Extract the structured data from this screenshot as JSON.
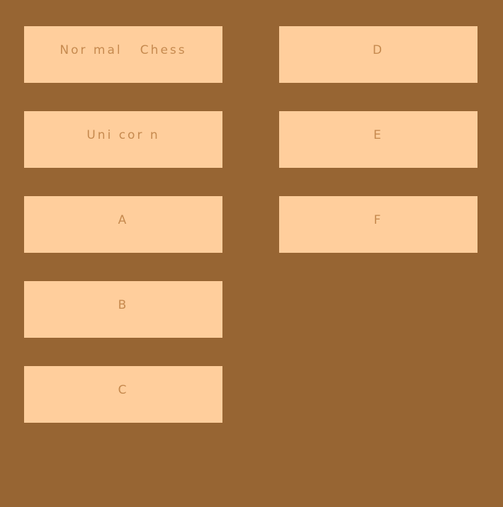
{
  "buttons": [
    {
      "label": "Nor mal   Chess"
    },
    {
      "label": "Uni cor n"
    },
    {
      "label": "A"
    },
    {
      "label": "B"
    },
    {
      "label": "C"
    },
    {
      "label": "D"
    },
    {
      "label": "E"
    },
    {
      "label": "F"
    }
  ],
  "colors": {
    "background": "#976533",
    "button_fill": "#ffce9c",
    "button_text": "#c68a4f"
  }
}
